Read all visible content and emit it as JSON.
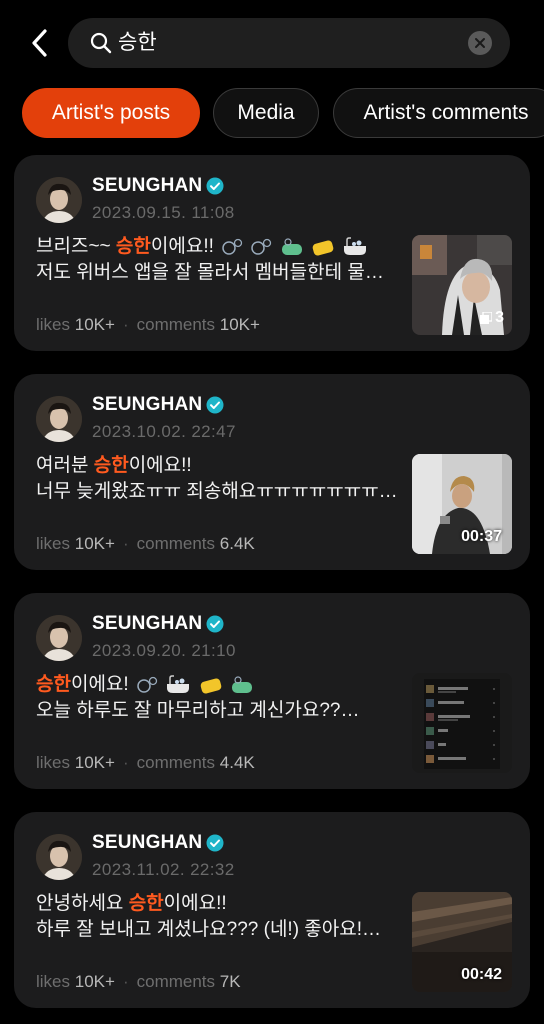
{
  "search": {
    "query": "승한"
  },
  "filters": [
    {
      "label": "Artist's posts",
      "active": true
    },
    {
      "label": "Media",
      "active": false
    },
    {
      "label": "Artist's comments",
      "active": false
    }
  ],
  "posts": [
    {
      "author": "SEUNGHAN",
      "date": "2023.09.15. 11:08",
      "line1_pre": "브리즈~~ ",
      "line1_hl": "승한",
      "line1_post": "이에요!!",
      "line2": "저도 위버스 앱을 잘 몰라서 멤버들한테 물…",
      "likes_label": "likes",
      "likes": "10K+",
      "comments_label": "comments",
      "comments": "10K+",
      "media_label": "3",
      "media_type": "photos"
    },
    {
      "author": "SEUNGHAN",
      "date": "2023.10.02. 22:47",
      "line1_pre": "여러분 ",
      "line1_hl": "승한",
      "line1_post": "이에요!!",
      "line2": "너무 늦게왔죠ㅠㅠ 죄송해요ㅠㅠㅠㅠㅠㅠㅠ…",
      "likes_label": "likes",
      "likes": "10K+",
      "comments_label": "comments",
      "comments": "6.4K",
      "media_label": "00:37",
      "media_type": "video"
    },
    {
      "author": "SEUNGHAN",
      "date": "2023.09.20. 21:10",
      "line1_pre": "",
      "line1_hl": "승한",
      "line1_post": "이에요!",
      "line2": "오늘 하루도 잘 마무리하고 계신가요??…",
      "likes_label": "likes",
      "likes": "10K+",
      "comments_label": "comments",
      "comments": "4.4K",
      "media_label": "",
      "media_type": "screenshot"
    },
    {
      "author": "SEUNGHAN",
      "date": "2023.11.02. 22:32",
      "line1_pre": "안녕하세요 ",
      "line1_hl": "승한",
      "line1_post": "이에요!!",
      "line2": "하루 잘 보내고 계셨나요??? (네!) 좋아요!…",
      "likes_label": "likes",
      "likes": "10K+",
      "comments_label": "comments",
      "comments": "7K",
      "media_label": "00:42",
      "media_type": "video"
    }
  ],
  "colors": {
    "accent": "#e3400b",
    "highlight": "#ff5a1f",
    "verified": "#1fb5c9",
    "card": "#1c1c1d"
  },
  "icons": [
    "back-arrow-icon",
    "search-icon",
    "clear-icon",
    "verified-icon",
    "bubbles-emoji",
    "soap-emoji",
    "bathtub-emoji",
    "photo-stack-icon"
  ]
}
